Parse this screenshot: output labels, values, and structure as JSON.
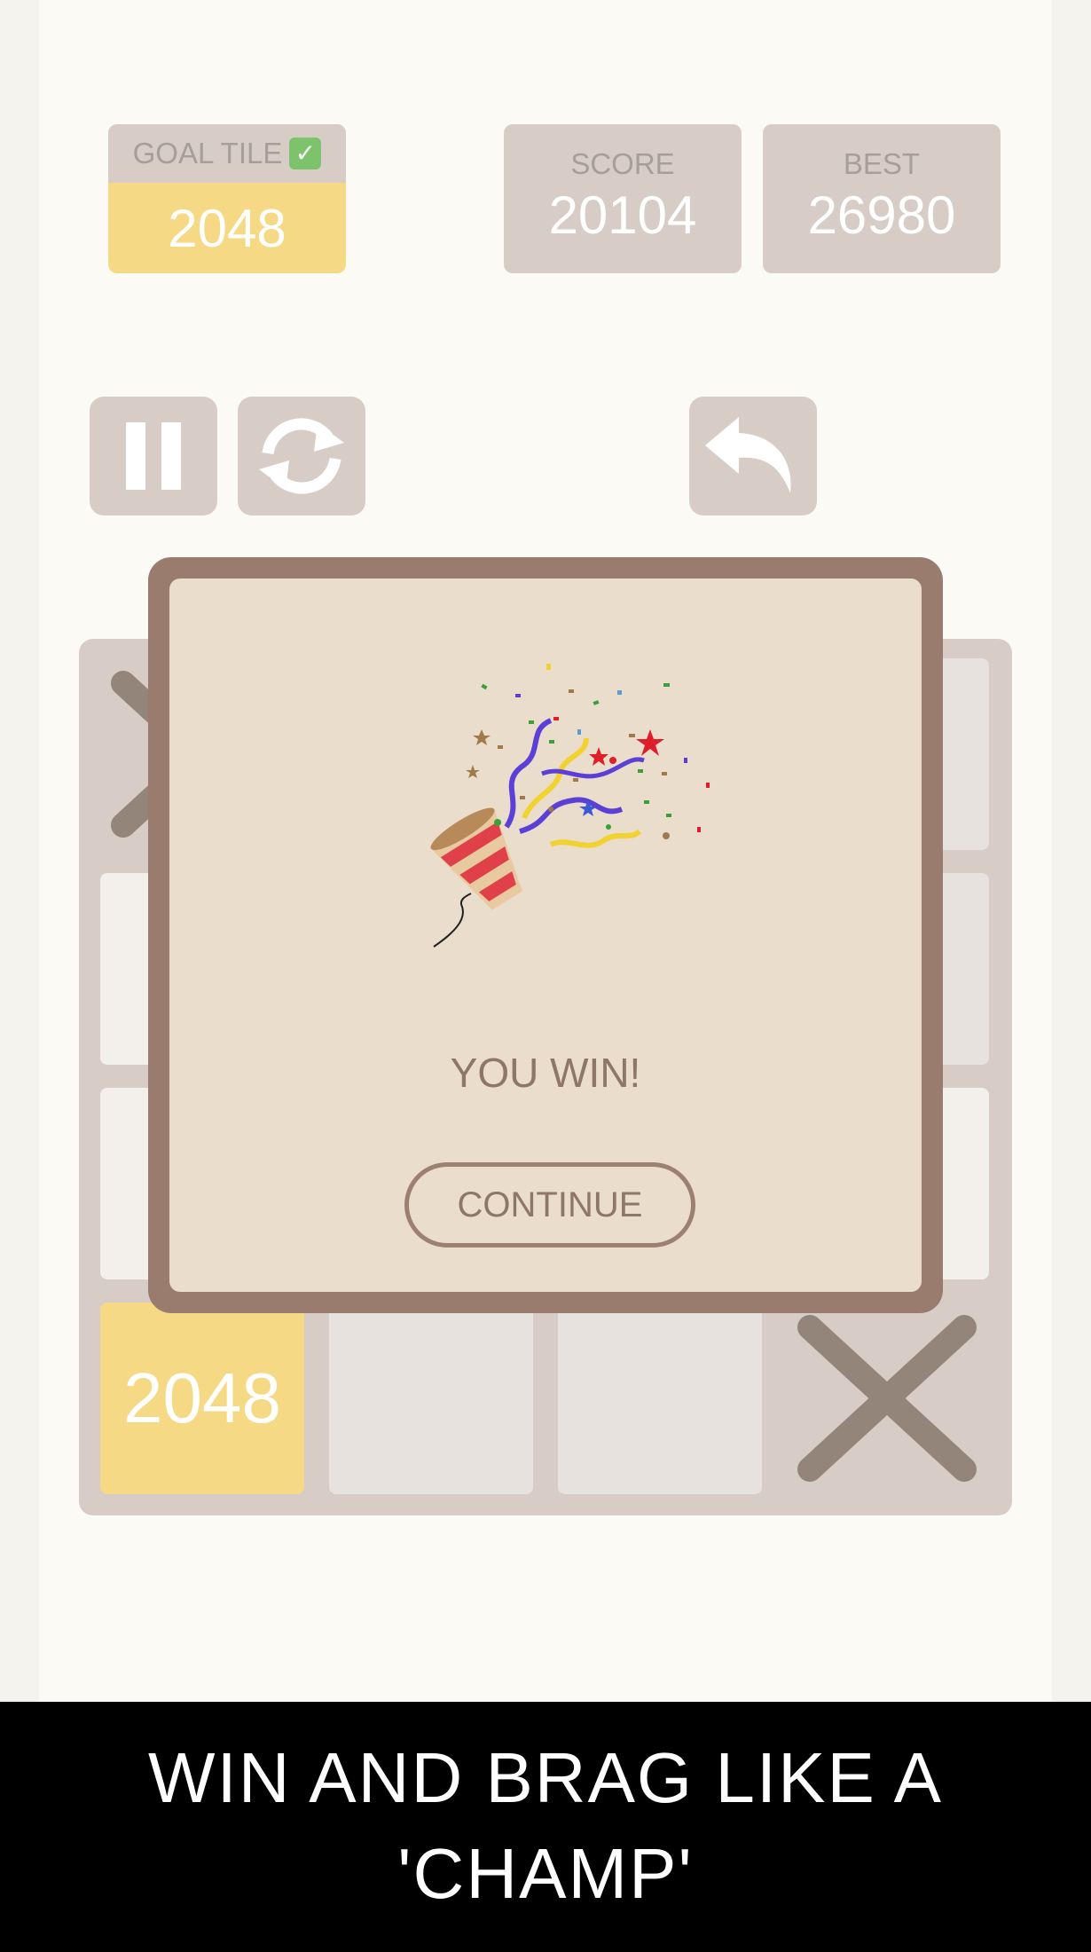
{
  "goal": {
    "label": "GOAL TILE",
    "check_icon": "check-icon",
    "value": "2048"
  },
  "score": {
    "label": "SCORE",
    "value": "20104"
  },
  "best": {
    "label": "BEST",
    "value": "26980"
  },
  "controls": {
    "pause_icon": "pause-icon",
    "restart_icon": "restart-icon",
    "undo_icon": "undo-icon"
  },
  "board": {
    "tile_2048": "2048",
    "blocked_icon": "x-mark-icon"
  },
  "dialog": {
    "illustration": "party-popper-icon",
    "message": "YOU WIN!",
    "continue_label": "CONTINUE"
  },
  "banner": {
    "text": "WIN AND BRAG LIKE A 'CHAMP'"
  },
  "colors": {
    "background": "#fbfaf5",
    "panel": "#d7cdc6",
    "gold_tile": "#f5d985",
    "dialog_border": "#997c6e",
    "dialog_fill": "#eaddcb",
    "text_brown": "#8e7767"
  }
}
